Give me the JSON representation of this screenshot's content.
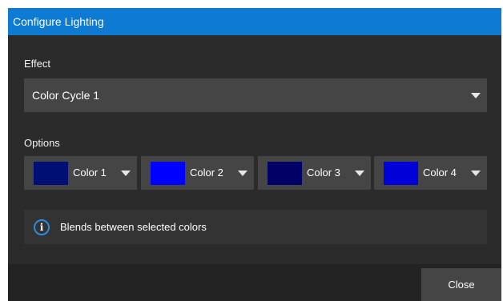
{
  "dialog": {
    "title": "Configure Lighting"
  },
  "effect": {
    "label": "Effect",
    "selected": "Color Cycle 1"
  },
  "options": {
    "label": "Options",
    "colors": [
      {
        "label": "Color 1",
        "swatch": "#000f73"
      },
      {
        "label": "Color 2",
        "swatch": "#0000fe"
      },
      {
        "label": "Color 3",
        "swatch": "#000066"
      },
      {
        "label": "Color 4",
        "swatch": "#0000d8"
      }
    ]
  },
  "info": {
    "icon": "info-icon",
    "text": "Blends between selected colors"
  },
  "footer": {
    "close_label": "Close"
  },
  "colors": {
    "title_bar": "#0f7ad2",
    "dialog_bg": "#2b2b2b",
    "control_bg": "#454545",
    "info_accent": "#2a8de0"
  }
}
